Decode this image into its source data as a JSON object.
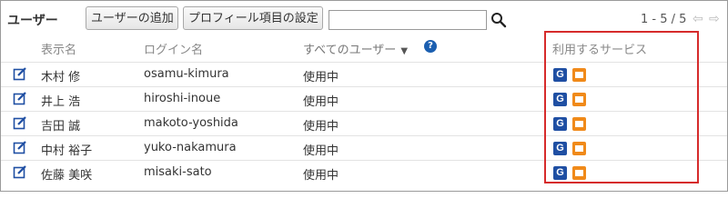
{
  "toolbar": {
    "title": "ユーザー",
    "add_user_label": "ユーザーの追加",
    "profile_settings_label": "プロフィール項目の設定",
    "search_value": "",
    "pager_text": "1 - 5 / 5",
    "prev_glyph": "⇦",
    "next_glyph": "⇨"
  },
  "table": {
    "headers": {
      "name": "表示名",
      "login": "ログイン名",
      "filter": "すべてのユーザー",
      "services": "利用するサービス"
    },
    "rows": [
      {
        "name": "木村 修",
        "login": "osamu-kimura",
        "status": "使用中"
      },
      {
        "name": "井上 浩",
        "login": "hiroshi-inoue",
        "status": "使用中"
      },
      {
        "name": "吉田 誠",
        "login": "makoto-yoshida",
        "status": "使用中"
      },
      {
        "name": "中村 裕子",
        "login": "yuko-nakamura",
        "status": "使用中"
      },
      {
        "name": "佐藤 美咲",
        "login": "misaki-sato",
        "status": "使用中"
      }
    ]
  },
  "icons": {
    "search": "search-icon",
    "edit": "edit-icon",
    "help": "help-icon",
    "service_g": "garoon-service-icon",
    "service_mail": "mail-service-icon",
    "service_g_letter": "G"
  },
  "colors": {
    "highlight_border": "#d62b2b",
    "service_g_bg": "#1f4fa3",
    "service_mail_bg": "#f08a1a",
    "help_icon_bg": "#1b5fb0"
  }
}
